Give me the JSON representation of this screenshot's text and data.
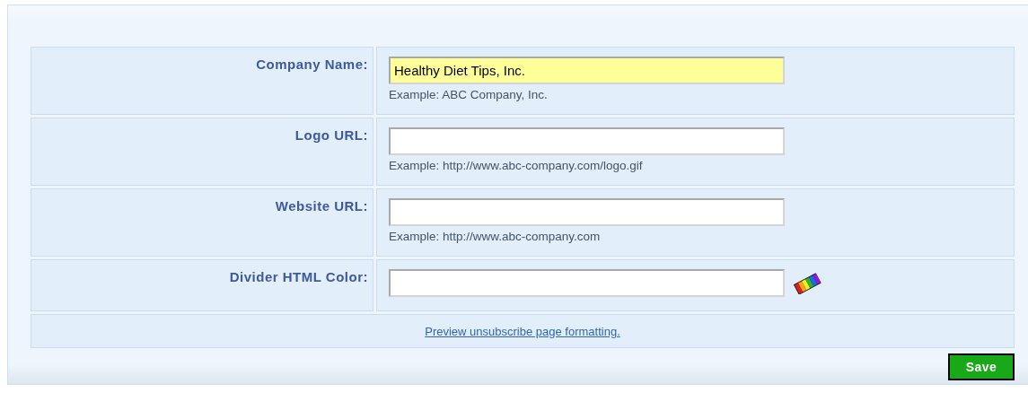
{
  "fields": [
    {
      "label": "Company Name:",
      "value": "Healthy Diet Tips, Inc.",
      "highlighted": true,
      "hint": "Example: ABC Company, Inc.",
      "kind": "text"
    },
    {
      "label": "Logo URL:",
      "highlighted": false,
      "hint": "Example: http://www.abc-company.com/logo.gif",
      "kind": "text"
    },
    {
      "label": "Website URL:",
      "highlighted": false,
      "hint": "Example: http://www.abc-company.com",
      "kind": "text"
    },
    {
      "label": "Divider HTML Color:",
      "highlighted": false,
      "kind": "color"
    }
  ],
  "preview_link": "Preview unsubscribe page formatting.",
  "save_button": "Save"
}
